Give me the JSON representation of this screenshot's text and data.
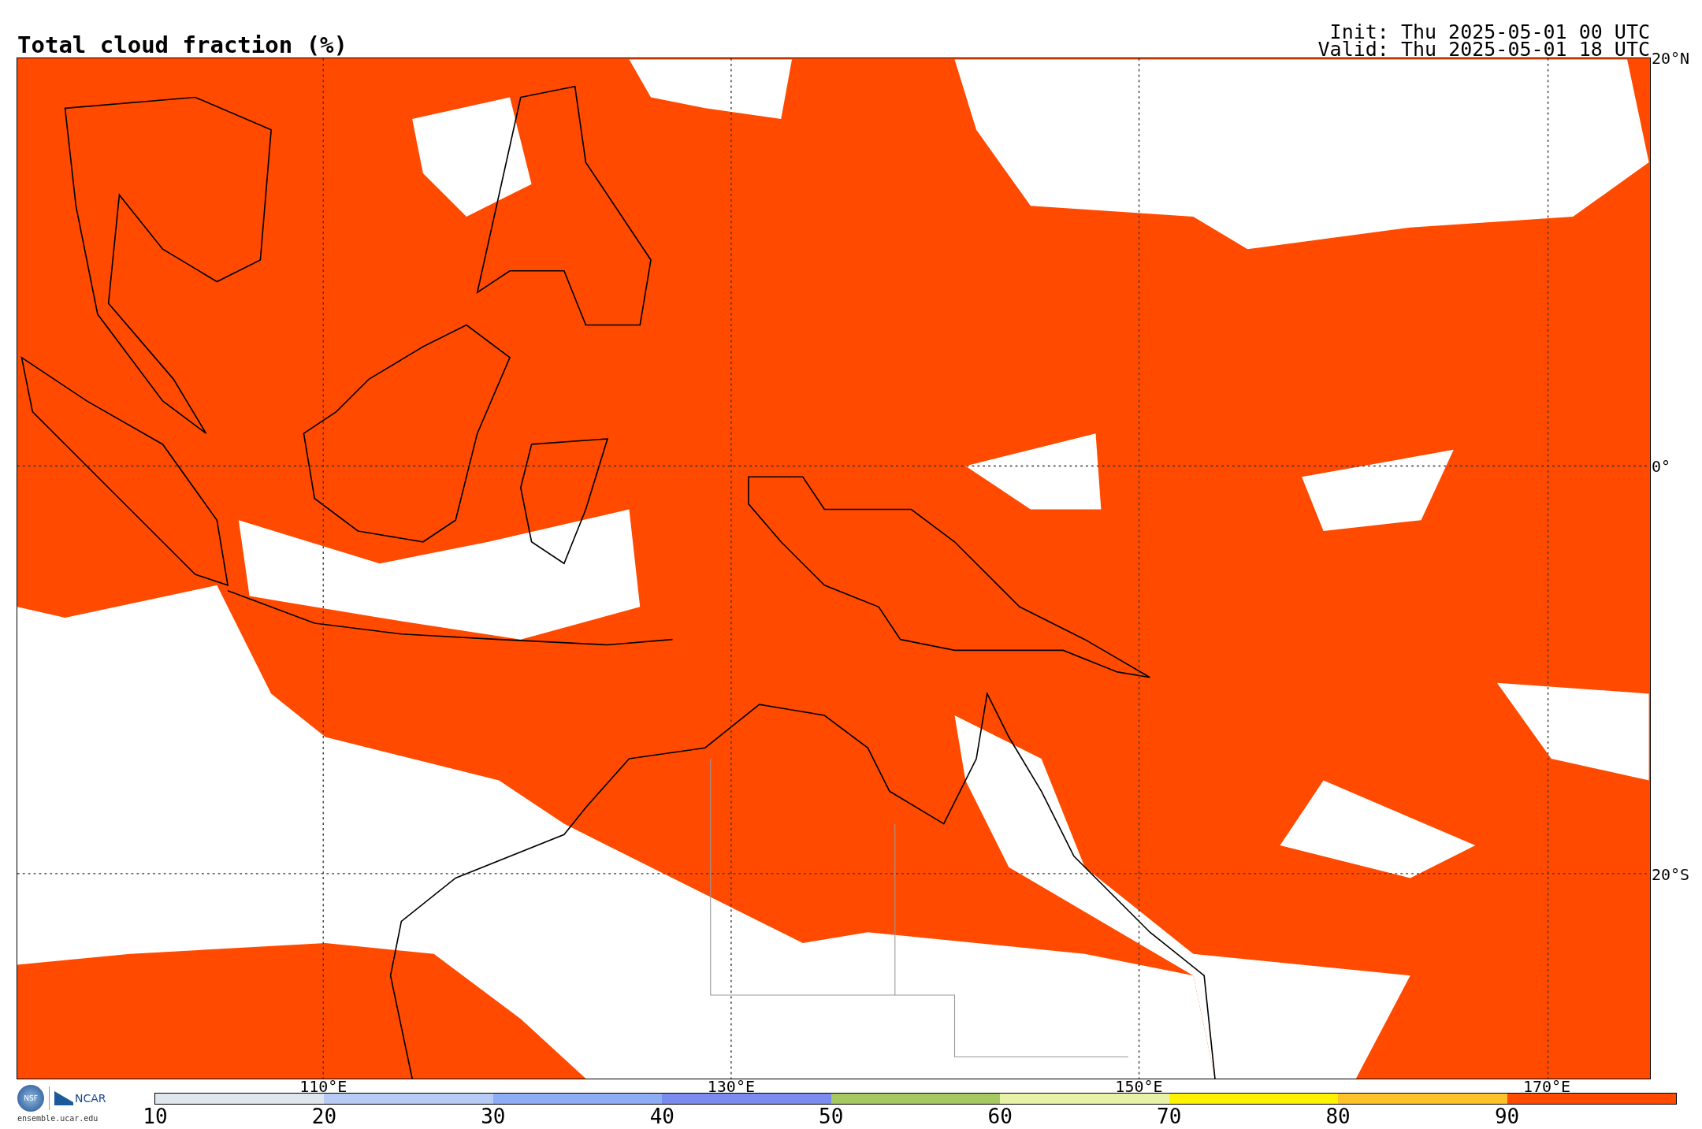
{
  "header": {
    "title": "Total cloud fraction (%)",
    "init": "Init: Thu 2025-05-01 00 UTC",
    "valid": "Valid: Thu 2025-05-01 18 UTC"
  },
  "map": {
    "lat_labels": [
      "20°N",
      "0°",
      "20°S"
    ],
    "lon_labels": [
      "110°E",
      "130°E",
      "150°E",
      "170°E"
    ]
  },
  "logos": {
    "nsf": "NSF",
    "ncar": "NCAR",
    "url": "ensemble.ucar.edu"
  },
  "colorbar": {
    "segments": [
      {
        "color": "#dfe6ee"
      },
      {
        "color": "#b8cbf4"
      },
      {
        "color": "#8fadf4"
      },
      {
        "color": "#7b8cf0"
      },
      {
        "color": "#a6c862"
      },
      {
        "color": "#e8f3a8"
      },
      {
        "color": "#fff200"
      },
      {
        "color": "#fdc22a"
      },
      {
        "color": "#ff4a00"
      }
    ],
    "ticks": [
      "10",
      "20",
      "30",
      "40",
      "50",
      "60",
      "70",
      "80",
      "90"
    ]
  }
}
